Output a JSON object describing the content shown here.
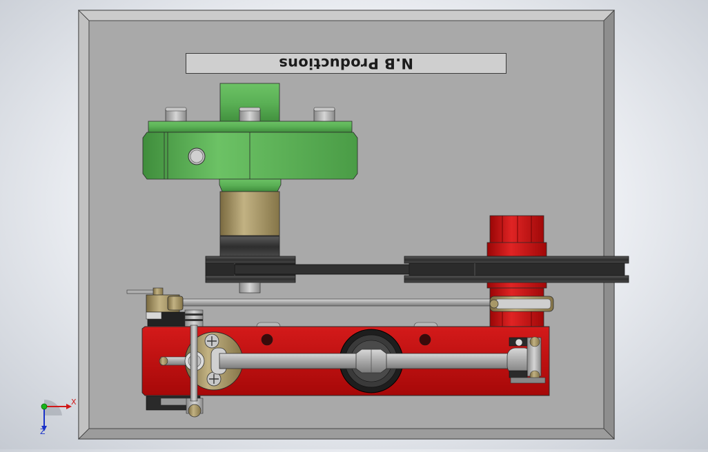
{
  "nameplate": {
    "text": "N.B Productions"
  },
  "triad": {
    "x_label": "X",
    "z_label": "Z"
  },
  "colors": {
    "frame": "#9a9a9a",
    "base_plate": "#a8a8a8",
    "green_part": "#5fb55a",
    "bronze_bushing": "#a89868",
    "red_part": "#c41010",
    "pulley": "#3c3c3c",
    "rod": "#a0a0a0"
  }
}
